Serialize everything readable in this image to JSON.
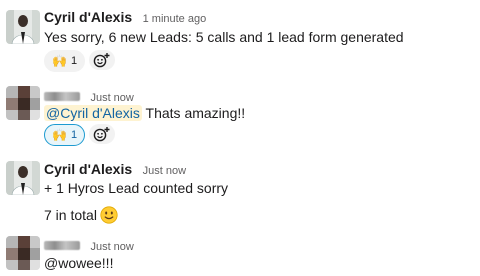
{
  "messages": [
    {
      "author": "Cyril d'Alexis",
      "time": "1 minute ago",
      "text": "Yes sorry, 6 new Leads: 5 calls and 1 lead form generated",
      "reaction": {
        "emoji": "🙌",
        "count": "1"
      }
    },
    {
      "author": "",
      "time": "Just now",
      "mention": "@Cyril d'Alexis",
      "text": "Thats amazing!!",
      "reaction": {
        "emoji": "🙌",
        "count": "1"
      }
    },
    {
      "author": "Cyril d'Alexis",
      "time": "Just now",
      "line1": "+ 1 Hyros Lead counted sorry",
      "line2": "7 in total",
      "line2_emoji": "slightly-smiling-face-icon"
    },
    {
      "author": "",
      "time": "Just now",
      "text": "@wowee!!!"
    }
  ],
  "colors": {
    "mention_bg": "#fef3d1",
    "mention_text": "#1264a3",
    "active_reaction_border": "#1d9bd1"
  }
}
